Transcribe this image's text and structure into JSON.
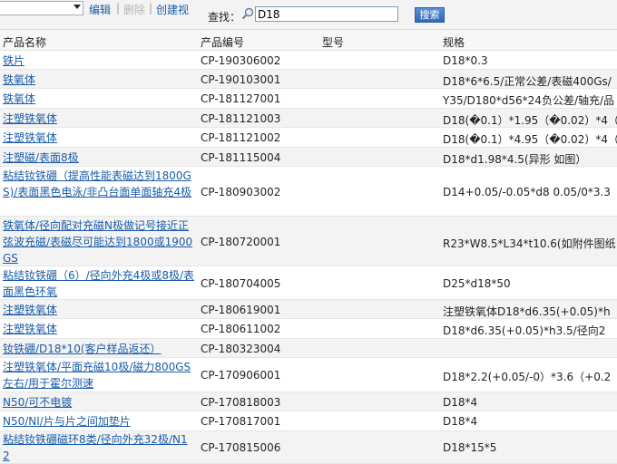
{
  "toolbar": {
    "view_select_value": "",
    "edit_label": "编辑",
    "delete_label": "删除",
    "create_view_label": "创建视",
    "search_label": "查找：",
    "search_value": "D18",
    "search_button": "搜索"
  },
  "table": {
    "columns": [
      "产品名称",
      "产品编号",
      "型号",
      "规格"
    ],
    "rows": [
      {
        "name": "铁片",
        "code": "CP-190306002",
        "model": "",
        "spec": "D18*0.3"
      },
      {
        "name": "铁氧体",
        "code": "CP-190103001",
        "model": "",
        "spec": "D18*6*6.5/正常公差/表磁400Gs/"
      },
      {
        "name": "铁氧体",
        "code": "CP-181127001",
        "model": "",
        "spec": "Y35/D180*d56*24负公差/轴充/品"
      },
      {
        "name": "注塑铁氧体",
        "code": "CP-181121003",
        "model": "",
        "spec": "D18(�0.1）*1.95（�0.02）*4（"
      },
      {
        "name": "注塑铁氧体",
        "code": "CP-181121002",
        "model": "",
        "spec": "D18(�0.1）*4.95（�0.02）*4（"
      },
      {
        "name": "注塑磁/表面8极",
        "code": "CP-181115004",
        "model": "",
        "spec": "D18*d1.98*4.5(异形 如图）"
      },
      {
        "name": "粘结钕铁硼（提高性能表磁达到1800GS)/表面黑色电泳/非凸台面单面轴充4极",
        "code": "CP-180903002",
        "model": "",
        "spec": "D14+0.05/-0.05*d8 0.05/0*3.3"
      },
      {
        "name": "铁氧体/径向配对充磁N极做记号接近正弦波充磁/表磁尽可能达到1800或1900GS",
        "code": "CP-180720001",
        "model": "",
        "spec": "R23*W8.5*L34*t10.6(如附件图纸"
      },
      {
        "name": "粘结钕铁硼（6）/径向外充4极或8极/表面黑色环氧",
        "code": "CP-180704005",
        "model": "",
        "spec": "D25*d18*50"
      },
      {
        "name": "注塑铁氧体",
        "code": "CP-180619001",
        "model": "",
        "spec": "注塑铁氧体D18*d6.35(+0.05)*h"
      },
      {
        "name": "注塑铁氧体",
        "code": "CP-180611002",
        "model": "",
        "spec": "D18*d6.35(+0.05)*h3.5/径向2"
      },
      {
        "name": "钕铁硼/D18*10(客户样品返还）",
        "code": "CP-180323004",
        "model": "",
        "spec": ""
      },
      {
        "name": "注塑铁氧体/平面充磁10极/磁力800GS左右/用于霍尔测速",
        "code": "CP-170906001",
        "model": "",
        "spec": "D18*2.2(+0.05/-0）*3.6（+0.2"
      },
      {
        "name": "N50/可不电镀",
        "code": "CP-170818003",
        "model": "",
        "spec": "D18*4"
      },
      {
        "name": "N50/NI/片与片之间加垫片",
        "code": "CP-170817001",
        "model": "",
        "spec": "D18*4"
      },
      {
        "name": "粘结钕铁硼磁环8类/径向外充32极/N12",
        "code": "CP-170815006",
        "model": "",
        "spec": "D18*15*5"
      }
    ]
  },
  "colors": {
    "link": "#1b5ca8",
    "alt_row": "#f3f3f3",
    "toolbar_bg": "#f3f3f3",
    "button": "#3a72c2"
  }
}
